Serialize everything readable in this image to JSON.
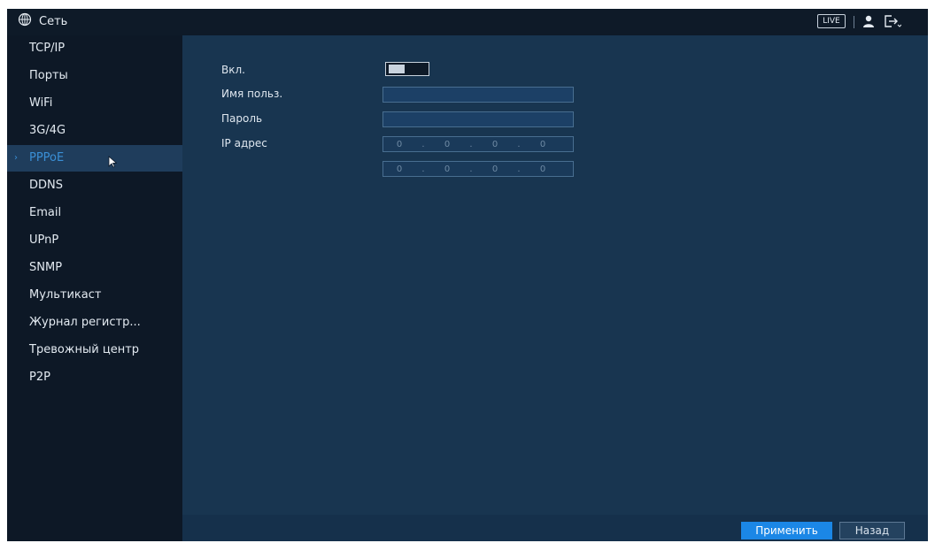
{
  "header": {
    "title": "Сеть",
    "title_icon": "globe-icon",
    "live_label": "LIVE",
    "user_icon": "user-icon",
    "logout_icon": "logout-icon"
  },
  "sidebar": {
    "items": [
      {
        "label": "TCP/IP"
      },
      {
        "label": "Порты"
      },
      {
        "label": "WiFi"
      },
      {
        "label": "3G/4G"
      },
      {
        "label": "PPPoE",
        "active": true
      },
      {
        "label": "DDNS"
      },
      {
        "label": "Email"
      },
      {
        "label": "UPnP"
      },
      {
        "label": "SNMP"
      },
      {
        "label": "Мультикаст"
      },
      {
        "label": "Журнал регистр..."
      },
      {
        "label": "Тревожный центр"
      },
      {
        "label": "P2P"
      }
    ]
  },
  "form": {
    "enable_label": "Вкл.",
    "enable_state": "on",
    "username_label": "Имя польз.",
    "username_value": "",
    "password_label": "Пароль",
    "password_value": "",
    "ip_label": "IP адрес",
    "ip_address": [
      "0",
      "0",
      "0",
      "0"
    ],
    "ip_address_2": [
      "0",
      "0",
      "0",
      "0"
    ]
  },
  "footer": {
    "apply_label": "Применить",
    "back_label": "Назад"
  },
  "colors": {
    "accent": "#1b87e6",
    "active_text": "#3a8fd6",
    "panel": "#183550",
    "sidebar": "#0d1826"
  }
}
